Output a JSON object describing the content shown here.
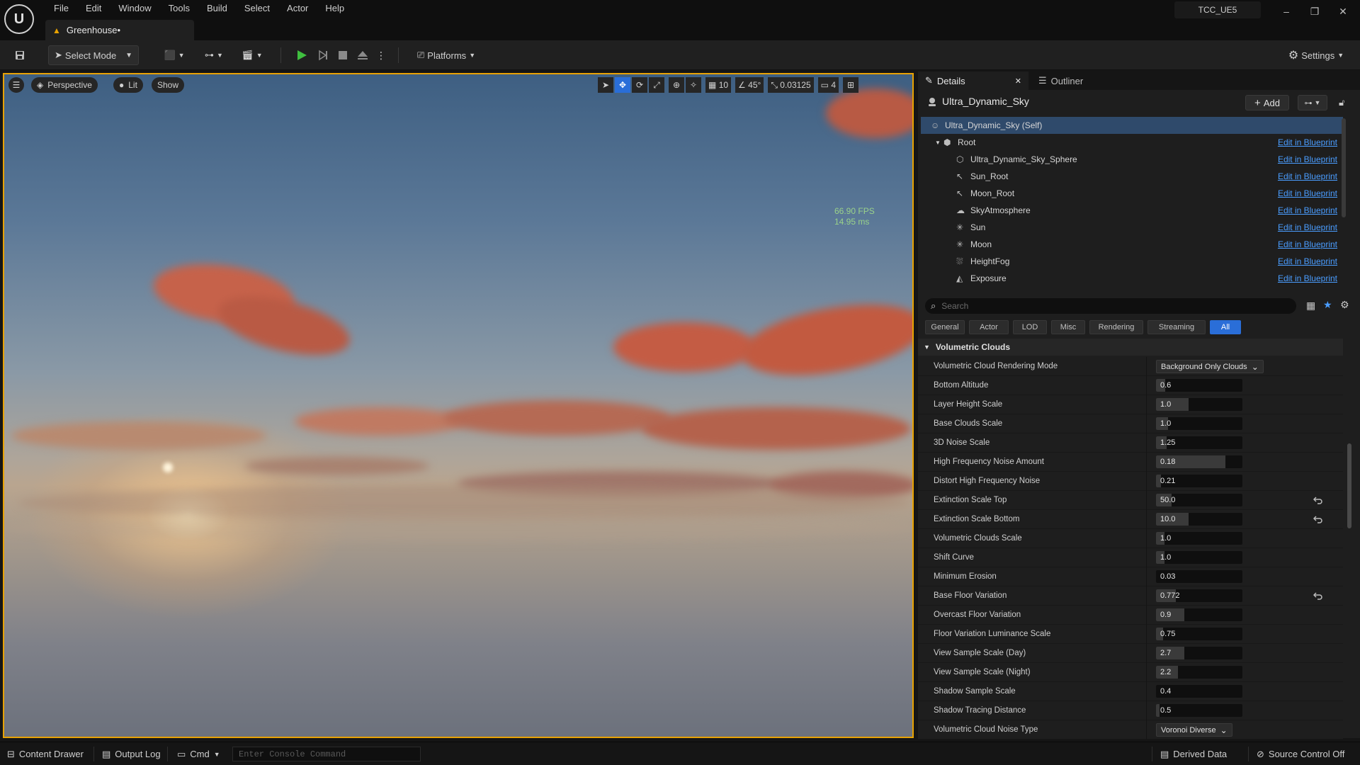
{
  "app": {
    "logo_text": "U",
    "project_name": "TCC_UE5",
    "document_tab": "Greenhouse•"
  },
  "menu": [
    "File",
    "Edit",
    "Window",
    "Tools",
    "Build",
    "Select",
    "Actor",
    "Help"
  ],
  "window_controls": {
    "minimize": "–",
    "restore": "❐",
    "close": "✕"
  },
  "toolbar": {
    "select_mode": "Select Mode",
    "platforms": "Platforms",
    "settings": "Settings"
  },
  "viewport": {
    "perspective": "Perspective",
    "lit": "Lit",
    "show": "Show",
    "grid_snap": "10",
    "angle_snap": "45°",
    "scale_snap": "0.03125",
    "camera_speed": "4",
    "fps": "66.90 FPS",
    "frame_ms": "14.95 ms"
  },
  "panel": {
    "details_tab": "Details",
    "outliner_tab": "Outliner",
    "actor_name": "Ultra_Dynamic_Sky",
    "add_label": "Add",
    "edit_in_blueprint": "Edit in Blueprint",
    "components": [
      {
        "label": "Ultra_Dynamic_Sky (Self)",
        "icon": "actor-icon",
        "indent": 0,
        "selected": true,
        "blueprint": false
      },
      {
        "label": "Root",
        "icon": "root-icon",
        "indent": 1,
        "selected": false,
        "blueprint": true
      },
      {
        "label": "Ultra_Dynamic_Sky_Sphere",
        "icon": "mesh-icon",
        "indent": 2,
        "selected": false,
        "blueprint": true
      },
      {
        "label": "Sun_Root",
        "icon": "arrow-icon",
        "indent": 2,
        "selected": false,
        "blueprint": true
      },
      {
        "label": "Moon_Root",
        "icon": "arrow-icon",
        "indent": 2,
        "selected": false,
        "blueprint": true
      },
      {
        "label": "SkyAtmosphere",
        "icon": "atmosphere-icon",
        "indent": 2,
        "selected": false,
        "blueprint": true
      },
      {
        "label": "Sun",
        "icon": "light-icon",
        "indent": 2,
        "selected": false,
        "blueprint": true
      },
      {
        "label": "Moon",
        "icon": "light-icon",
        "indent": 2,
        "selected": false,
        "blueprint": true
      },
      {
        "label": "HeightFog",
        "icon": "fog-icon",
        "indent": 2,
        "selected": false,
        "blueprint": true
      },
      {
        "label": "Exposure",
        "icon": "exposure-icon",
        "indent": 2,
        "selected": false,
        "blueprint": true
      }
    ],
    "search_placeholder": "Search",
    "filters": [
      {
        "label": "General",
        "active": false
      },
      {
        "label": "Actor",
        "active": false
      },
      {
        "label": "LOD",
        "active": false
      },
      {
        "label": "Misc",
        "active": false
      },
      {
        "label": "Rendering",
        "active": false
      },
      {
        "label": "Streaming",
        "active": false
      },
      {
        "label": "All",
        "active": true
      }
    ],
    "section_title": "Volumetric Clouds",
    "properties": [
      {
        "label": "Volumetric Cloud Rendering Mode",
        "type": "combo",
        "value": "Background Only Clouds",
        "reset": false
      },
      {
        "label": "Bottom Altitude",
        "type": "num",
        "value": "0.6",
        "fill": 0.11,
        "reset": false
      },
      {
        "label": "Layer Height Scale",
        "type": "num",
        "value": "1.0",
        "fill": 0.38,
        "reset": false
      },
      {
        "label": "Base Clouds Scale",
        "type": "num",
        "value": "1.0",
        "fill": 0.14,
        "reset": false
      },
      {
        "label": "3D Noise Scale",
        "type": "num",
        "value": "1.25",
        "fill": 0.12,
        "reset": false
      },
      {
        "label": "High Frequency Noise Amount",
        "type": "num",
        "value": "0.18",
        "fill": 0.8,
        "reset": false
      },
      {
        "label": "Distort High Frequency Noise",
        "type": "num",
        "value": "0.21",
        "fill": 0.06,
        "reset": false
      },
      {
        "label": "Extinction Scale Top",
        "type": "num",
        "value": "50.0",
        "fill": 0.18,
        "reset": true
      },
      {
        "label": "Extinction Scale Bottom",
        "type": "num",
        "value": "10.0",
        "fill": 0.38,
        "reset": true
      },
      {
        "label": "Volumetric Clouds Scale",
        "type": "num",
        "value": "1.0",
        "fill": 0.1,
        "reset": false
      },
      {
        "label": "Shift Curve",
        "type": "num",
        "value": "1.0",
        "fill": 0.1,
        "reset": false
      },
      {
        "label": "Minimum Erosion",
        "type": "num",
        "value": "0.03",
        "fill": 0.0,
        "reset": false
      },
      {
        "label": "Base Floor Variation",
        "type": "num",
        "value": "0.772",
        "fill": 0.23,
        "reset": true
      },
      {
        "label": "Overcast Floor Variation",
        "type": "num",
        "value": "0.9",
        "fill": 0.33,
        "reset": false
      },
      {
        "label": "Floor Variation Luminance Scale",
        "type": "num",
        "value": "0.75",
        "fill": 0.08,
        "reset": false
      },
      {
        "label": "View Sample Scale (Day)",
        "type": "num",
        "value": "2.7",
        "fill": 0.33,
        "reset": false
      },
      {
        "label": "View Sample Scale (Night)",
        "type": "num",
        "value": "2.2",
        "fill": 0.25,
        "reset": false
      },
      {
        "label": "Shadow Sample Scale",
        "type": "num",
        "value": "0.4",
        "fill": 0.0,
        "reset": false
      },
      {
        "label": "Shadow Tracing Distance",
        "type": "num",
        "value": "0.5",
        "fill": 0.04,
        "reset": false
      },
      {
        "label": "Volumetric Cloud Noise Type",
        "type": "combo",
        "value": "Voronoi Diverse",
        "reset": false
      }
    ]
  },
  "statusbar": {
    "content_drawer": "Content Drawer",
    "output_log": "Output Log",
    "cmd": "Cmd",
    "console_placeholder": "Enter Console Command",
    "derived_data": "Derived Data",
    "source_control": "Source Control Off"
  },
  "colors": {
    "accent_blue": "#2a6ed8",
    "viewport_border": "#e8a200",
    "link_blue": "#4a9dff",
    "play_green": "#3fbf3f"
  }
}
